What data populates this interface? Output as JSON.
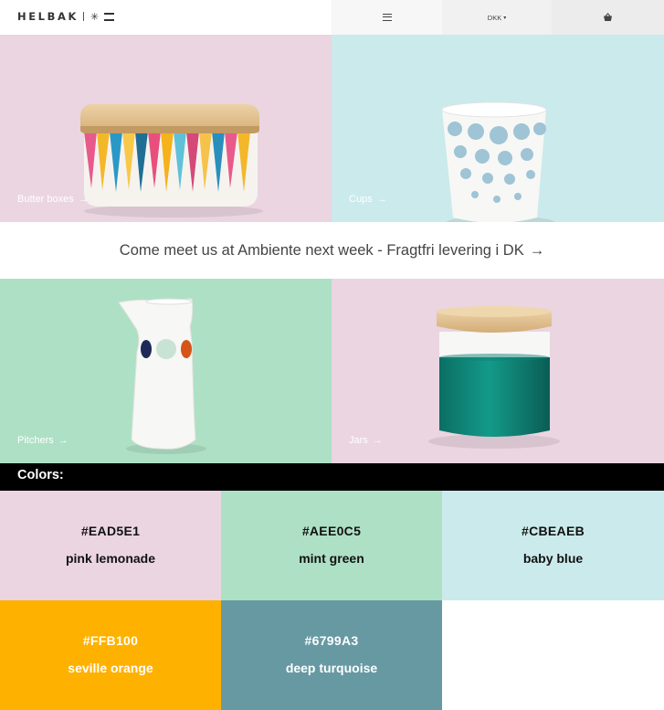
{
  "header": {
    "logo_text": "HELBAK",
    "logo_symbol": "✳",
    "menu_icon": "hamburger-menu-icon",
    "currency": "DKK",
    "basket_icon": "basket-icon"
  },
  "tiles": [
    {
      "label": "Butter boxes",
      "arrow": "→",
      "color": "#EAD5E1"
    },
    {
      "label": "Cups",
      "arrow": "→",
      "color": "#CBEAEB"
    },
    {
      "label": "Pitchers",
      "arrow": "→",
      "color": "#AEE0C5"
    },
    {
      "label": "Jars",
      "arrow": "→",
      "color": "#EAD5E1"
    }
  ],
  "banner": {
    "text": "Come meet us at Ambiente next week - Fragtfri levering i DK",
    "arrow": "→"
  },
  "colors": {
    "heading": "Colors:",
    "swatches": [
      {
        "hex": "#EAD5E1",
        "name": "pink lemonade"
      },
      {
        "hex": "#AEE0C5",
        "name": "mint green"
      },
      {
        "hex": "#CBEAEB",
        "name": "baby blue"
      },
      {
        "hex": "#FFB100",
        "name": "seville orange"
      },
      {
        "hex": "#6799A3",
        "name": "deep turquoise"
      }
    ]
  }
}
